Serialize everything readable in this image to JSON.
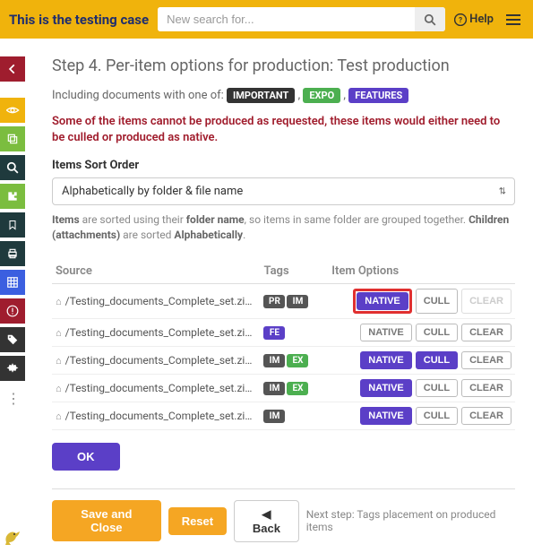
{
  "header": {
    "title": "This is the testing case",
    "search_placeholder": "New search for...",
    "help_label": "Help"
  },
  "step": {
    "title": "Step 4. Per-item options for production: Test production",
    "including_prefix": "Including documents with one of:",
    "tags": {
      "important": "IMPORTANT",
      "expo": "EXPO",
      "features": "FEATURES"
    },
    "warning": "Some of the items cannot be produced as requested, these items would either need to be culled or produced as native.",
    "sort_label": "Items Sort Order",
    "sort_value": "Alphabetically by folder & file name",
    "sort_hint_1": "Items",
    "sort_hint_2": " are sorted using their ",
    "sort_hint_3": "folder name",
    "sort_hint_4": ", so items in same folder are grouped together. ",
    "sort_hint_5": "Children (attachments)",
    "sort_hint_6": " are sorted ",
    "sort_hint_7": "Alphabetically",
    "sort_hint_8": "."
  },
  "table": {
    "col_source": "Source",
    "col_tags": "Tags",
    "col_options": "Item Options",
    "opt_native": "NATIVE",
    "opt_cull": "CULL",
    "opt_clear": "CLEAR",
    "rows": [
      {
        "source": "/Testing_documents_Complete_set.zip/DeD",
        "tags": [
          "PR",
          "IM"
        ],
        "tag_styles": [
          "mt-dark",
          "mt-dark"
        ],
        "native": "active",
        "cull": "",
        "clear": "disabled",
        "highlight": true
      },
      {
        "source": "/Testing_documents_Complete_set.zip/DeD",
        "tags": [
          "FE"
        ],
        "tag_styles": [
          "mt-purple"
        ],
        "native": "",
        "cull": "",
        "clear": ""
      },
      {
        "source": "/Testing_documents_Complete_set.zip/Hilla",
        "tags": [
          "IM",
          "EX"
        ],
        "tag_styles": [
          "mt-dark",
          "mt-green"
        ],
        "native": "active",
        "cull": "active",
        "clear": ""
      },
      {
        "source": "/Testing_documents_Complete_set.zip/Hilla",
        "tags": [
          "IM",
          "EX"
        ],
        "tag_styles": [
          "mt-dark",
          "mt-green"
        ],
        "native": "active",
        "cull": "",
        "clear": ""
      },
      {
        "source": "/Testing_documents_Complete_set.zip/Hilla",
        "tags": [
          "IM"
        ],
        "tag_styles": [
          "mt-dark"
        ],
        "native": "active",
        "cull": "",
        "clear": ""
      }
    ]
  },
  "buttons": {
    "ok": "OK",
    "save_close": "Save and Close",
    "reset": "Reset",
    "back": "Back",
    "next_step": "Next step: Tags placement on produced items"
  }
}
